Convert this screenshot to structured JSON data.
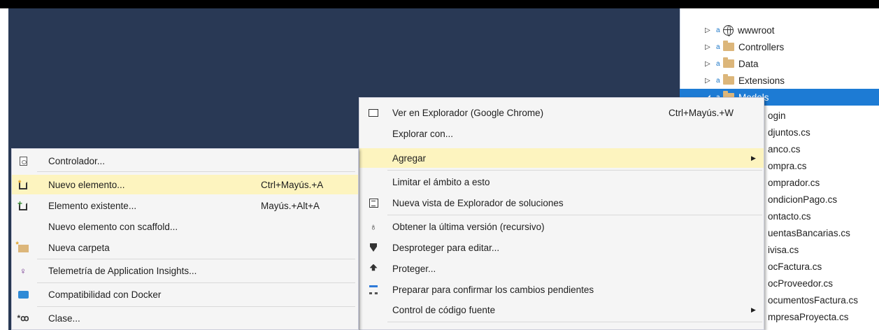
{
  "solution_explorer": {
    "folders": [
      {
        "name": "wwwroot",
        "icon": "globe-icon"
      },
      {
        "name": "Controllers",
        "icon": "folder-icon"
      },
      {
        "name": "Data",
        "icon": "folder-icon"
      },
      {
        "name": "Extensions",
        "icon": "folder-icon"
      },
      {
        "name": "Models",
        "icon": "folder-icon",
        "selected": true
      }
    ],
    "files": [
      "ogin",
      "djuntos.cs",
      "anco.cs",
      "ompra.cs",
      "omprador.cs",
      "ondicionPago.cs",
      "ontacto.cs",
      "uentasBancarias.cs",
      "ivisa.cs",
      "ocFactura.cs",
      "ocProveedor.cs",
      "ocumentosFactura.cs",
      "mpresaProyecta.cs"
    ]
  },
  "context_menu": {
    "items": [
      {
        "label": "Ver en Explorador (Google Chrome)",
        "shortcut": "Ctrl+Mayús.+W",
        "icon": "browser-icon"
      },
      {
        "label": "Explorar con...",
        "shortcut": "",
        "icon": ""
      },
      {
        "label": "Agregar",
        "shortcut": "",
        "icon": "",
        "submenu": true,
        "highlighted": true
      },
      {
        "label": "Limitar el ámbito a esto",
        "shortcut": "",
        "icon": ""
      },
      {
        "label": "Nueva vista de Explorador de soluciones",
        "shortcut": "",
        "icon": "new-window-icon"
      },
      {
        "label": "Obtener la última versión (recursivo)",
        "shortcut": "",
        "icon": "get-latest-icon"
      },
      {
        "label": "Desproteger para editar...",
        "shortcut": "",
        "icon": "checkout-icon"
      },
      {
        "label": "Proteger...",
        "shortcut": "",
        "icon": "checkin-icon"
      },
      {
        "label": "Preparar para confirmar los cambios pendientes",
        "shortcut": "",
        "icon": "pending-changes-icon"
      },
      {
        "label": "Control de código fuente",
        "shortcut": "",
        "icon": "",
        "submenu": true
      }
    ]
  },
  "add_submenu": {
    "items": [
      {
        "label": "Controlador...",
        "shortcut": "",
        "icon": "controller-icon"
      },
      {
        "label": "Nuevo elemento...",
        "shortcut": "Ctrl+Mayús.+A",
        "icon": "new-item-icon",
        "highlighted": true
      },
      {
        "label": "Elemento existente...",
        "shortcut": "Mayús.+Alt+A",
        "icon": "existing-item-icon"
      },
      {
        "label": "Nuevo elemento con scaffold...",
        "shortcut": "",
        "icon": ""
      },
      {
        "label": "Nueva carpeta",
        "shortcut": "",
        "icon": "new-folder-icon"
      },
      {
        "label": "Telemetría de Application Insights...",
        "shortcut": "",
        "icon": "app-insights-icon"
      },
      {
        "label": "Compatibilidad con Docker",
        "shortcut": "",
        "icon": "docker-icon"
      },
      {
        "label": "Clase...",
        "shortcut": "",
        "icon": "class-icon"
      }
    ]
  }
}
